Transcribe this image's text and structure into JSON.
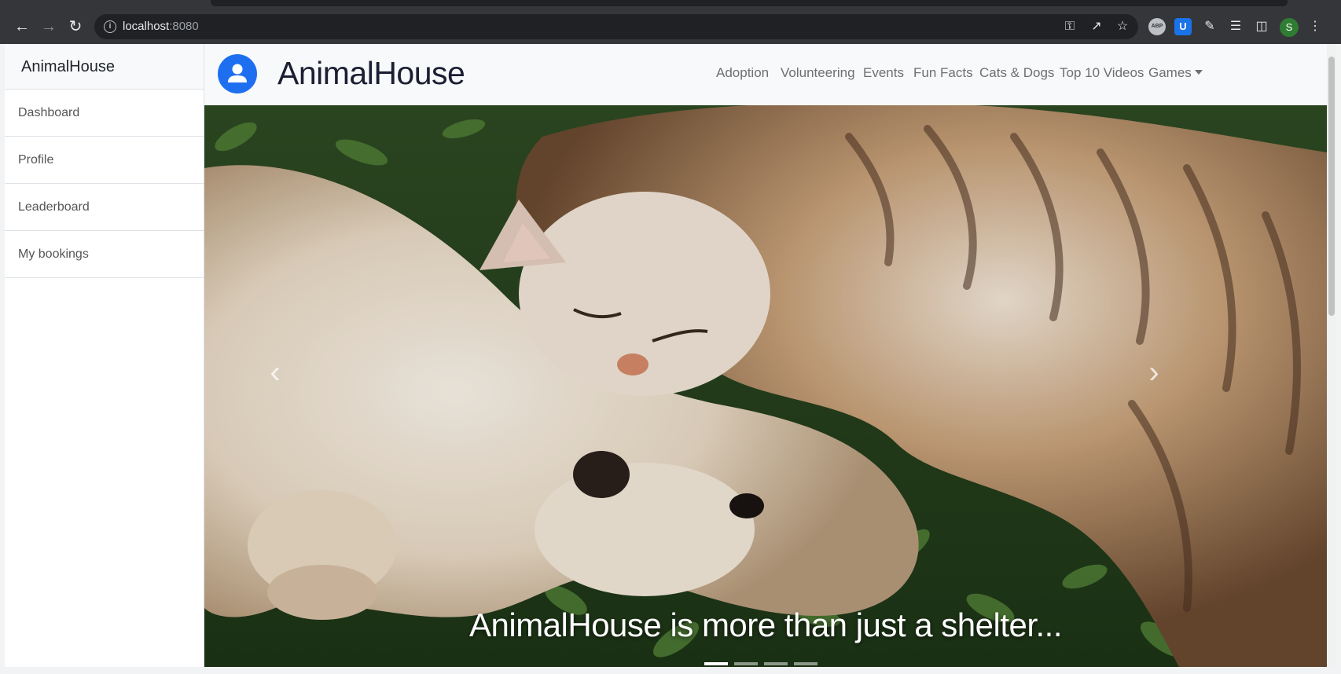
{
  "browser": {
    "url_host": "localhost",
    "url_port": ":8080",
    "profile_initial": "S",
    "abp_label": "ABP",
    "bitwarden_label": "U"
  },
  "sidebar": {
    "brand": "AnimalHouse",
    "items": [
      {
        "label": "Dashboard"
      },
      {
        "label": "Profile"
      },
      {
        "label": "Leaderboard"
      },
      {
        "label": "My bookings"
      }
    ]
  },
  "navbar": {
    "brand": "AnimalHouse",
    "links": [
      {
        "label": "Adoption"
      },
      {
        "label": "Volunteering"
      },
      {
        "label": "Events"
      },
      {
        "label": "Fun Facts"
      },
      {
        "label": "Cats & Dogs"
      },
      {
        "label": "Top 10 Videos"
      },
      {
        "label": "Games"
      }
    ]
  },
  "carousel": {
    "caption": "AnimalHouse is more than just a shelter...",
    "slide_count": 4,
    "active_slide": 1
  },
  "colors": {
    "accent": "#1e6ff0",
    "navbar_bg": "#f8f9fa",
    "chrome_bg": "#35363a"
  },
  "icons": {
    "back": "arrow-left-icon",
    "forward": "arrow-right-icon",
    "reload": "reload-icon",
    "info": "info-icon",
    "key": "key-icon",
    "share": "share-icon",
    "star": "star-icon",
    "extensions": "puzzle-icon",
    "media": "media-icon",
    "sidepanel": "side-panel-icon",
    "menu": "kebab-menu-icon",
    "user": "user-icon"
  }
}
